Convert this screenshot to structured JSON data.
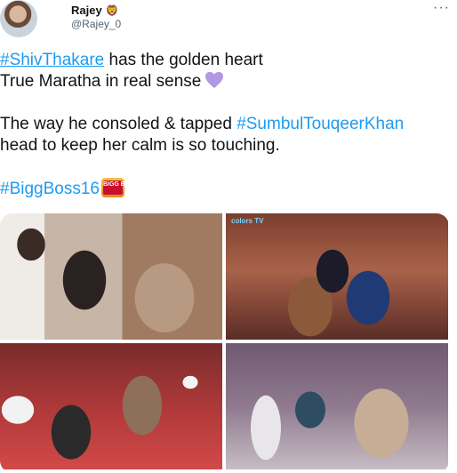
{
  "author": {
    "display_name": "Rajey",
    "badge_emoji": "🦁",
    "handle": "@Rajey_0",
    "avatar_icon": "profile-avatar"
  },
  "menu": {
    "more_label": "···"
  },
  "tweet": {
    "line1_tag": "#ShivThakare",
    "line1_text": " has the golden heart",
    "line2_text": "True Maratha in real sense",
    "line3_text": "The way he consoled & tapped ",
    "line3_tag": "#SumbulTouqeerKhan",
    "line4_text": "head to keep her calm is so touching.",
    "line5_tag": "#BiggBoss16",
    "heart_color": "#b197e6",
    "hashtag_color": "#1d9bf0"
  },
  "media": {
    "logo_text": "BIGG BOSS",
    "tv_mark": "colors TV"
  }
}
